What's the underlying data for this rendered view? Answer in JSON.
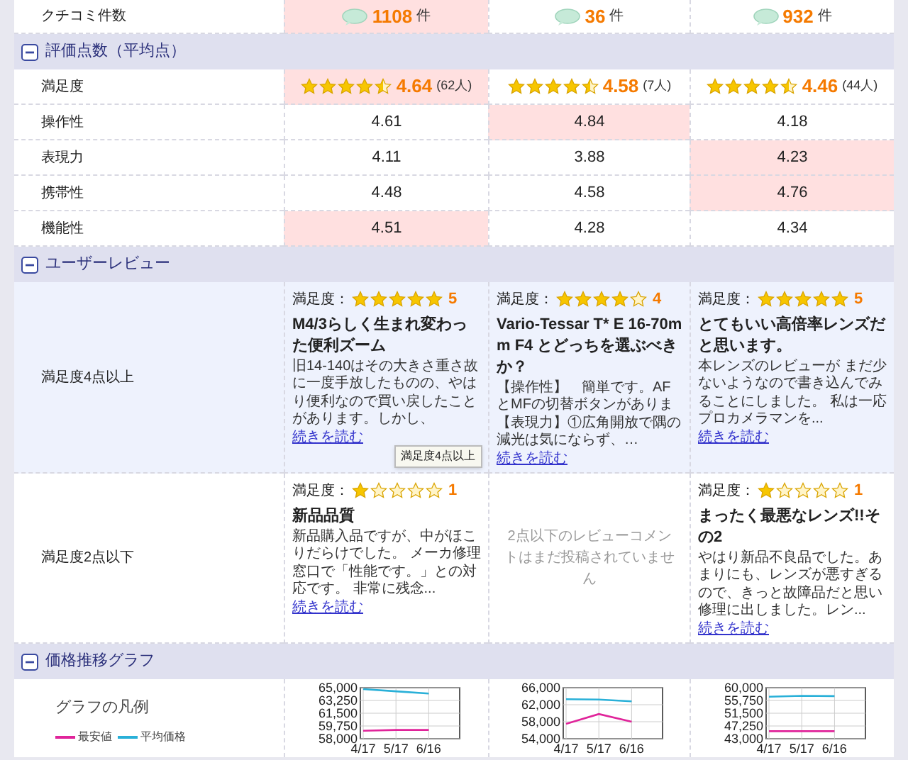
{
  "comment_row": {
    "label": "クチコミ件数",
    "cells": [
      {
        "count": "1108",
        "unit": "件",
        "highlighted": true
      },
      {
        "count": "36",
        "unit": "件",
        "highlighted": false
      },
      {
        "count": "932",
        "unit": "件",
        "highlighted": false
      }
    ]
  },
  "ratings": {
    "title": "評価点数（平均点）",
    "expanded": true,
    "satisfaction": {
      "label": "満足度",
      "cells": [
        {
          "stars": 4.5,
          "score": "4.64",
          "reviewers": "(62人)",
          "highlighted": true
        },
        {
          "stars": 4.5,
          "score": "4.58",
          "reviewers": "(7人)",
          "highlighted": false
        },
        {
          "stars": 4.5,
          "score": "4.46",
          "reviewers": "(44人)",
          "highlighted": false
        }
      ]
    },
    "rows": [
      {
        "label": "操作性",
        "cells": [
          {
            "value": "4.61",
            "highlighted": false
          },
          {
            "value": "4.84",
            "highlighted": true
          },
          {
            "value": "4.18",
            "highlighted": false
          }
        ]
      },
      {
        "label": "表現力",
        "cells": [
          {
            "value": "4.11",
            "highlighted": false
          },
          {
            "value": "3.88",
            "highlighted": false
          },
          {
            "value": "4.23",
            "highlighted": true
          }
        ]
      },
      {
        "label": "携帯性",
        "cells": [
          {
            "value": "4.48",
            "highlighted": false
          },
          {
            "value": "4.58",
            "highlighted": false
          },
          {
            "value": "4.76",
            "highlighted": true
          }
        ]
      },
      {
        "label": "機能性",
        "cells": [
          {
            "value": "4.51",
            "highlighted": true
          },
          {
            "value": "4.28",
            "highlighted": false
          },
          {
            "value": "4.34",
            "highlighted": false
          }
        ]
      }
    ]
  },
  "reviews": {
    "title": "ユーザーレビュー",
    "expanded": true,
    "rows": [
      {
        "label": "満足度4点以上",
        "cells": [
          {
            "kind": "review",
            "rating_label": "満足度：",
            "stars": 5,
            "score": "5",
            "title": "M4/3らしく生まれ変わった便利ズーム",
            "body": "旧14-140はその大きさ重さ故に一度手放したものの、やはり便利なので買い戻したことがあります。しかし、",
            "more": "続きを読む"
          },
          {
            "kind": "review",
            "rating_label": "満足度：",
            "stars": 4,
            "score": "4",
            "title": "Vario-Tessar T* E 16-70mm F4 とどっちを選ぶべきか？",
            "body": "【操作性】　簡単です。AFとMFの切替ボタンがありま【表現力】①広角開放で隅の減光は気にならず、…",
            "more": "続きを読む"
          },
          {
            "kind": "review",
            "rating_label": "満足度：",
            "stars": 5,
            "score": "5",
            "title": "とてもいい高倍率レンズだと思います。",
            "body": "本レンズのレビューが まだ少ないようなので書き込んでみることにしました。 私は一応プロカメラマンを...",
            "more": "続きを読む"
          }
        ]
      },
      {
        "label": "満足度2点以下",
        "cells": [
          {
            "kind": "review",
            "rating_label": "満足度：",
            "stars": 1,
            "score": "1",
            "title": "新品品質",
            "body": "新品購入品ですが、中がほこりだらけでした。 メーカ修理窓口で「性能です。」との対応です。 非常に残念...",
            "more": "続きを読む"
          },
          {
            "kind": "empty",
            "message": "2点以下のレビューコメントはまだ投稿されていません"
          },
          {
            "kind": "review",
            "rating_label": "満足度：",
            "stars": 1,
            "score": "1",
            "title": "まったく最悪なレンズ!!その2",
            "body": "やはり新品不良品でした。あまりにも、レンズが悪すぎるので、きっと故障品だと思い修理に出しました。レン...",
            "more": "続きを読む"
          }
        ]
      }
    ],
    "tooltip": "満足度4点以上"
  },
  "price_graph": {
    "title": "価格推移グラフ",
    "expanded": true,
    "legend_title": "グラフの凡例",
    "legend": [
      {
        "name": "最安値",
        "color": "#e0249a"
      },
      {
        "name": "平均価格",
        "color": "#29b0d8"
      }
    ],
    "charts": [
      {
        "chart_data": {
          "type": "line",
          "categories": [
            "4/17",
            "5/17",
            "6/16"
          ],
          "grid": true,
          "ylim": [
            58000,
            65000
          ],
          "yticks": [
            {
              "value": 58000,
              "label": "58,000"
            },
            {
              "value": 59750,
              "label": "59,750"
            },
            {
              "value": 61500,
              "label": "61,500"
            },
            {
              "value": 63250,
              "label": "63,250"
            },
            {
              "value": 65000,
              "label": "65,000"
            }
          ],
          "series": [
            {
              "color": "#e0249a",
              "values": [
                59100,
                59200,
                59200
              ]
            },
            {
              "color": "#29b0d8",
              "values": [
                64800,
                64500,
                64200
              ]
            }
          ]
        }
      },
      {
        "chart_data": {
          "type": "line",
          "categories": [
            "4/17",
            "5/17",
            "6/16"
          ],
          "grid": true,
          "ylim": [
            54000,
            66000
          ],
          "yticks": [
            {
              "value": 54000,
              "label": "54,000"
            },
            {
              "value": 58000,
              "label": "58,000"
            },
            {
              "value": 62000,
              "label": "62,000"
            },
            {
              "value": 66000,
              "label": "66,000"
            }
          ],
          "series": [
            {
              "color": "#e0249a",
              "values": [
                57500,
                59800,
                58000
              ]
            },
            {
              "color": "#29b0d8",
              "values": [
                63300,
                63200,
                62800
              ]
            }
          ]
        }
      },
      {
        "chart_data": {
          "type": "line",
          "categories": [
            "4/17",
            "5/17",
            "6/16"
          ],
          "grid": true,
          "ylim": [
            43000,
            60000
          ],
          "yticks": [
            {
              "value": 43000,
              "label": "43,000"
            },
            {
              "value": 47250,
              "label": "47,250"
            },
            {
              "value": 51500,
              "label": "51,500"
            },
            {
              "value": 55750,
              "label": "55,750"
            },
            {
              "value": 60000,
              "label": "60,000"
            }
          ],
          "series": [
            {
              "color": "#e0249a",
              "values": [
                45500,
                45500,
                45500
              ]
            },
            {
              "color": "#29b0d8",
              "values": [
                57000,
                57300,
                57200
              ]
            }
          ]
        }
      }
    ]
  }
}
